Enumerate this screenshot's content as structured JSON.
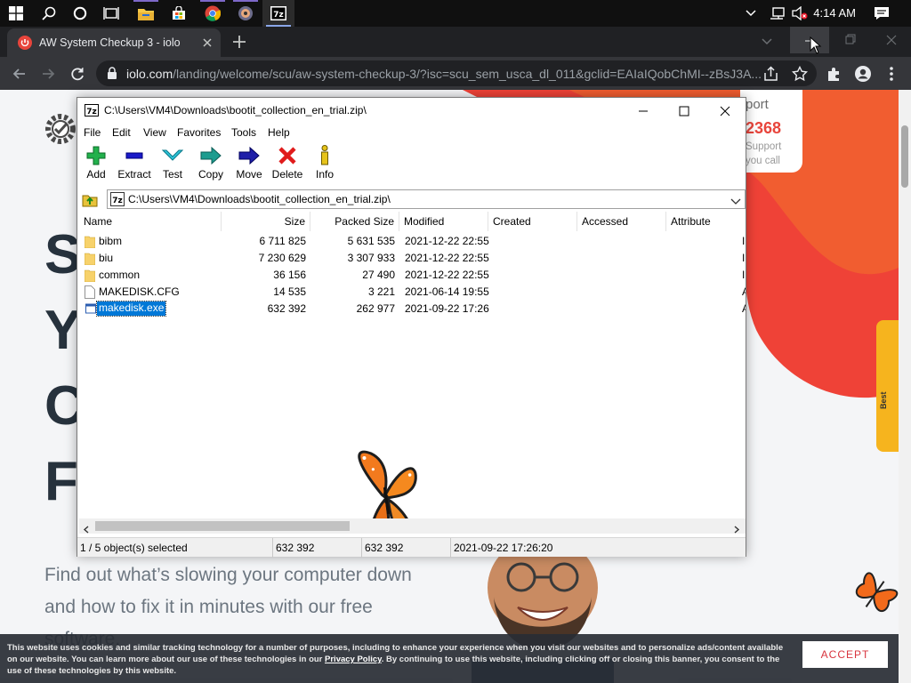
{
  "taskbar": {
    "clock": "4:14 AM",
    "apps": [
      "search-icon",
      "cortana-icon",
      "task-view-icon",
      "file-explorer-icon",
      "store-icon",
      "chrome-icon",
      "media-icon",
      "7zip-icon"
    ]
  },
  "browser": {
    "tab_title": "AW System Checkup 3 - iolo",
    "url_host": "iolo.com",
    "url_path": "/landing/welcome/scu/aw-system-checkup-3/?isc=scu_sem_usca_dl_011&gclid=EAIaIQobChMI--zBsJ3A..."
  },
  "site": {
    "big_letters": [
      "S",
      "Y",
      "C",
      "F"
    ],
    "subtitle": "Find out what’s slowing your computer down and how to fix it in minutes with our free software.",
    "support_partial": "port",
    "phone_partial": "2368",
    "support_line1": "Support",
    "support_line2": "you call",
    "side_badge": "Best",
    "cookie_text_a": "This website uses cookies and similar tracking technology for a number of purposes, including to enhance your experience when you visit our websites and to personalize ads/content available on our website. You can learn more about our use of these technologies in our ",
    "cookie_link": "Privacy Policy",
    "cookie_text_b": ". By continuing to use this website, including clicking off or closing this banner, you consent to the use of these technologies by this website.",
    "accept_label": "ACCEPT"
  },
  "zip": {
    "title": "C:\\Users\\VM4\\Downloads\\bootit_collection_en_trial.zip\\",
    "menu": [
      "File",
      "Edit",
      "View",
      "Favorites",
      "Tools",
      "Help"
    ],
    "tools": [
      "Add",
      "Extract",
      "Test",
      "Copy",
      "Move",
      "Delete",
      "Info"
    ],
    "path": "C:\\Users\\VM4\\Downloads\\bootit_collection_en_trial.zip\\",
    "columns": [
      "Name",
      "Size",
      "Packed Size",
      "Modified",
      "Created",
      "Accessed",
      "Attribute"
    ],
    "rows": [
      {
        "name": "bibm",
        "size": "6 711 825",
        "packed": "5 631 535",
        "modified": "2021-12-22 22:55",
        "attr": "I",
        "type": "folder"
      },
      {
        "name": "biu",
        "size": "7 230 629",
        "packed": "3 307 933",
        "modified": "2021-12-22 22:55",
        "attr": "I",
        "type": "folder"
      },
      {
        "name": "common",
        "size": "36 156",
        "packed": "27 490",
        "modified": "2021-12-22 22:55",
        "attr": "I",
        "type": "folder"
      },
      {
        "name": "MAKEDISK.CFG",
        "size": "14 535",
        "packed": "3 221",
        "modified": "2021-06-14 19:55",
        "attr": "A",
        "type": "file"
      },
      {
        "name": "makedisk.exe",
        "size": "632 392",
        "packed": "262 977",
        "modified": "2021-09-22 17:26",
        "attr": "A",
        "type": "exe",
        "selected": true
      }
    ],
    "status": [
      "1 / 5 object(s) selected",
      "632 392",
      "632 392",
      "2021-09-22 17:26:20"
    ]
  },
  "colors": {
    "selection": "#0078d7",
    "accent_red": "#e8453c",
    "cookie_bg": "#2c3038"
  }
}
